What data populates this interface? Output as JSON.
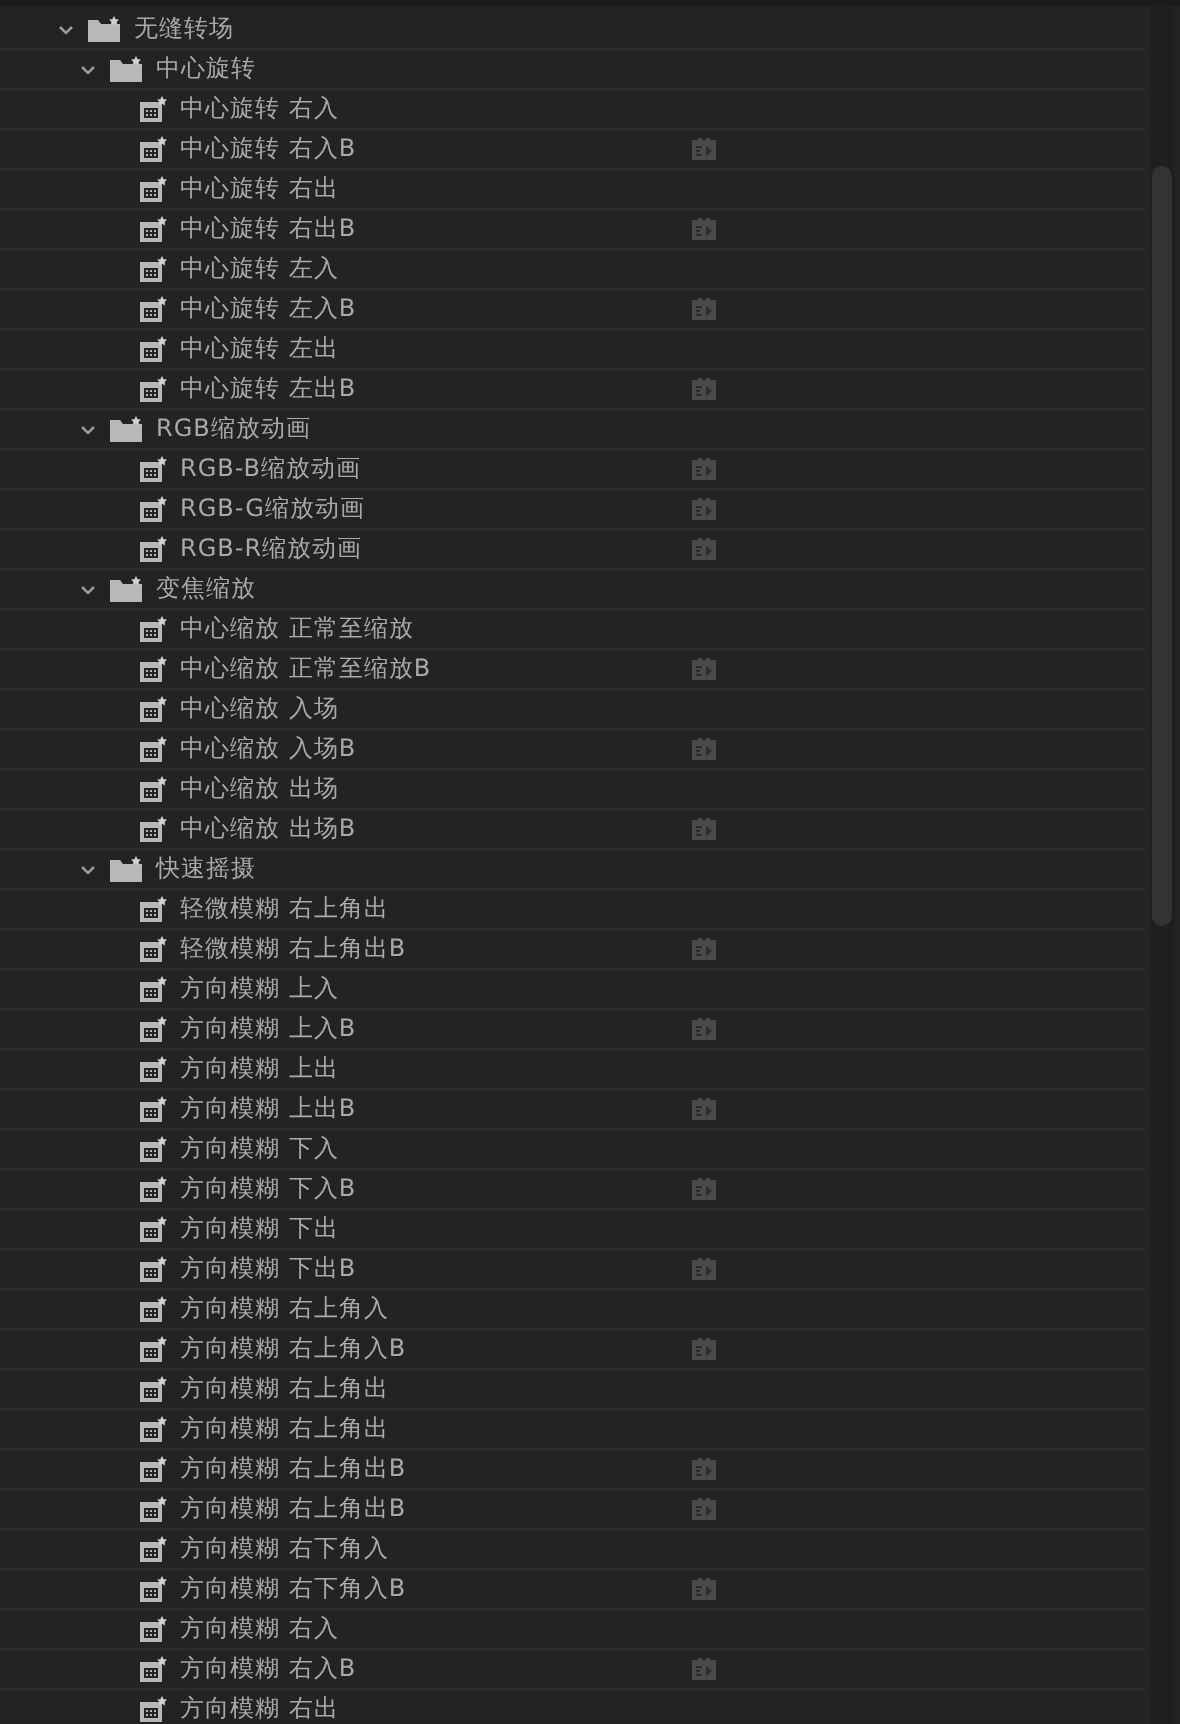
{
  "tree": [
    {
      "label": "无缝转场",
      "expanded": true,
      "children": [
        {
          "label": "中心旋转",
          "expanded": true,
          "children": [
            {
              "label": "中心旋转 右入",
              "badge": false
            },
            {
              "label": "中心旋转 右入B",
              "badge": true
            },
            {
              "label": "中心旋转 右出",
              "badge": false
            },
            {
              "label": "中心旋转 右出B",
              "badge": true
            },
            {
              "label": "中心旋转 左入",
              "badge": false
            },
            {
              "label": "中心旋转 左入B",
              "badge": true
            },
            {
              "label": "中心旋转 左出",
              "badge": false
            },
            {
              "label": "中心旋转 左出B",
              "badge": true
            }
          ]
        },
        {
          "label": "RGB缩放动画",
          "expanded": true,
          "children": [
            {
              "label": "RGB-B缩放动画",
              "badge": true
            },
            {
              "label": "RGB-G缩放动画",
              "badge": true
            },
            {
              "label": "RGB-R缩放动画",
              "badge": true
            }
          ]
        },
        {
          "label": "变焦缩放",
          "expanded": true,
          "children": [
            {
              "label": "中心缩放 正常至缩放",
              "badge": false
            },
            {
              "label": "中心缩放 正常至缩放B",
              "badge": true
            },
            {
              "label": "中心缩放 入场",
              "badge": false
            },
            {
              "label": "中心缩放 入场B",
              "badge": true
            },
            {
              "label": "中心缩放 出场",
              "badge": false
            },
            {
              "label": "中心缩放 出场B",
              "badge": true
            }
          ]
        },
        {
          "label": "快速摇摄",
          "expanded": true,
          "children": [
            {
              "label": "轻微模糊 右上角出",
              "badge": false
            },
            {
              "label": "轻微模糊 右上角出B",
              "badge": true
            },
            {
              "label": "方向模糊 上入",
              "badge": false
            },
            {
              "label": "方向模糊 上入B",
              "badge": true
            },
            {
              "label": "方向模糊 上出",
              "badge": false
            },
            {
              "label": "方向模糊 上出B",
              "badge": true
            },
            {
              "label": "方向模糊 下入",
              "badge": false
            },
            {
              "label": "方向模糊 下入B",
              "badge": true
            },
            {
              "label": "方向模糊 下出",
              "badge": false
            },
            {
              "label": "方向模糊 下出B",
              "badge": true
            },
            {
              "label": "方向模糊 右上角入",
              "badge": false
            },
            {
              "label": "方向模糊 右上角入B",
              "badge": true
            },
            {
              "label": "方向模糊 右上角出",
              "badge": false
            },
            {
              "label": "方向模糊 右上角出",
              "badge": false
            },
            {
              "label": "方向模糊 右上角出B",
              "badge": true
            },
            {
              "label": "方向模糊 右上角出B",
              "badge": true
            },
            {
              "label": "方向模糊 右下角入",
              "badge": false
            },
            {
              "label": "方向模糊 右下角入B",
              "badge": true
            },
            {
              "label": "方向模糊 右入",
              "badge": false
            },
            {
              "label": "方向模糊 右入B",
              "badge": true
            },
            {
              "label": "方向模糊 右出",
              "badge": false
            }
          ]
        }
      ]
    }
  ]
}
